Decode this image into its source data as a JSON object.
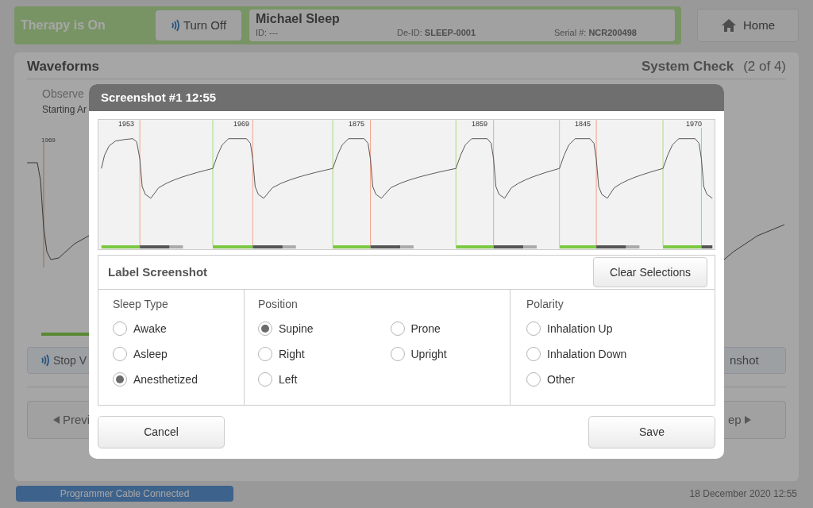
{
  "header": {
    "therapy_status": "Therapy is On",
    "therapy_button": "Turn Off",
    "patient_name": "Michael Sleep",
    "patient_id": "ID: ---",
    "deid_label": "De-ID:",
    "deid_value": "SLEEP-0001",
    "serial_label": "Serial #:",
    "serial_value": "NCR200498",
    "home_button": "Home"
  },
  "panel": {
    "title": "Waveforms",
    "step_title": "System Check",
    "step_count": "(2 of 4)",
    "instruction": "Observe",
    "instruction_detail": "Starting Ar",
    "chart_label": "1969",
    "stop_button": "Stop V",
    "screenshot_button": "nshot",
    "previous_button": "Previ",
    "next_button": "ep"
  },
  "status_bar": {
    "connection": "Programmer Cable Connected",
    "datetime": "18 December 2020 12:55"
  },
  "dialog": {
    "title": "Screenshot #1 12:55",
    "breath_labels": [
      "1953",
      "1969",
      "1875",
      "1859",
      "1845",
      "1970"
    ],
    "label_section": {
      "title": "Label Screenshot",
      "clear_button": "Clear Selections"
    },
    "groups": [
      {
        "title": "Sleep Type",
        "options": [
          {
            "label": "Awake",
            "selected": false
          },
          {
            "label": "Asleep",
            "selected": false
          },
          {
            "label": "Anesthetized",
            "selected": true
          }
        ]
      },
      {
        "title": "Position",
        "options": [
          {
            "label": "Supine",
            "selected": true
          },
          {
            "label": "Prone",
            "selected": false
          },
          {
            "label": "Right",
            "selected": false
          },
          {
            "label": "Upright",
            "selected": false
          },
          {
            "label": "Left",
            "selected": false
          }
        ]
      },
      {
        "title": "Polarity",
        "options": [
          {
            "label": "Inhalation Up",
            "selected": false
          },
          {
            "label": "Inhalation Down",
            "selected": false
          },
          {
            "label": "Other",
            "selected": false
          }
        ]
      }
    ],
    "buttons": {
      "cancel": "Cancel",
      "save": "Save"
    }
  }
}
